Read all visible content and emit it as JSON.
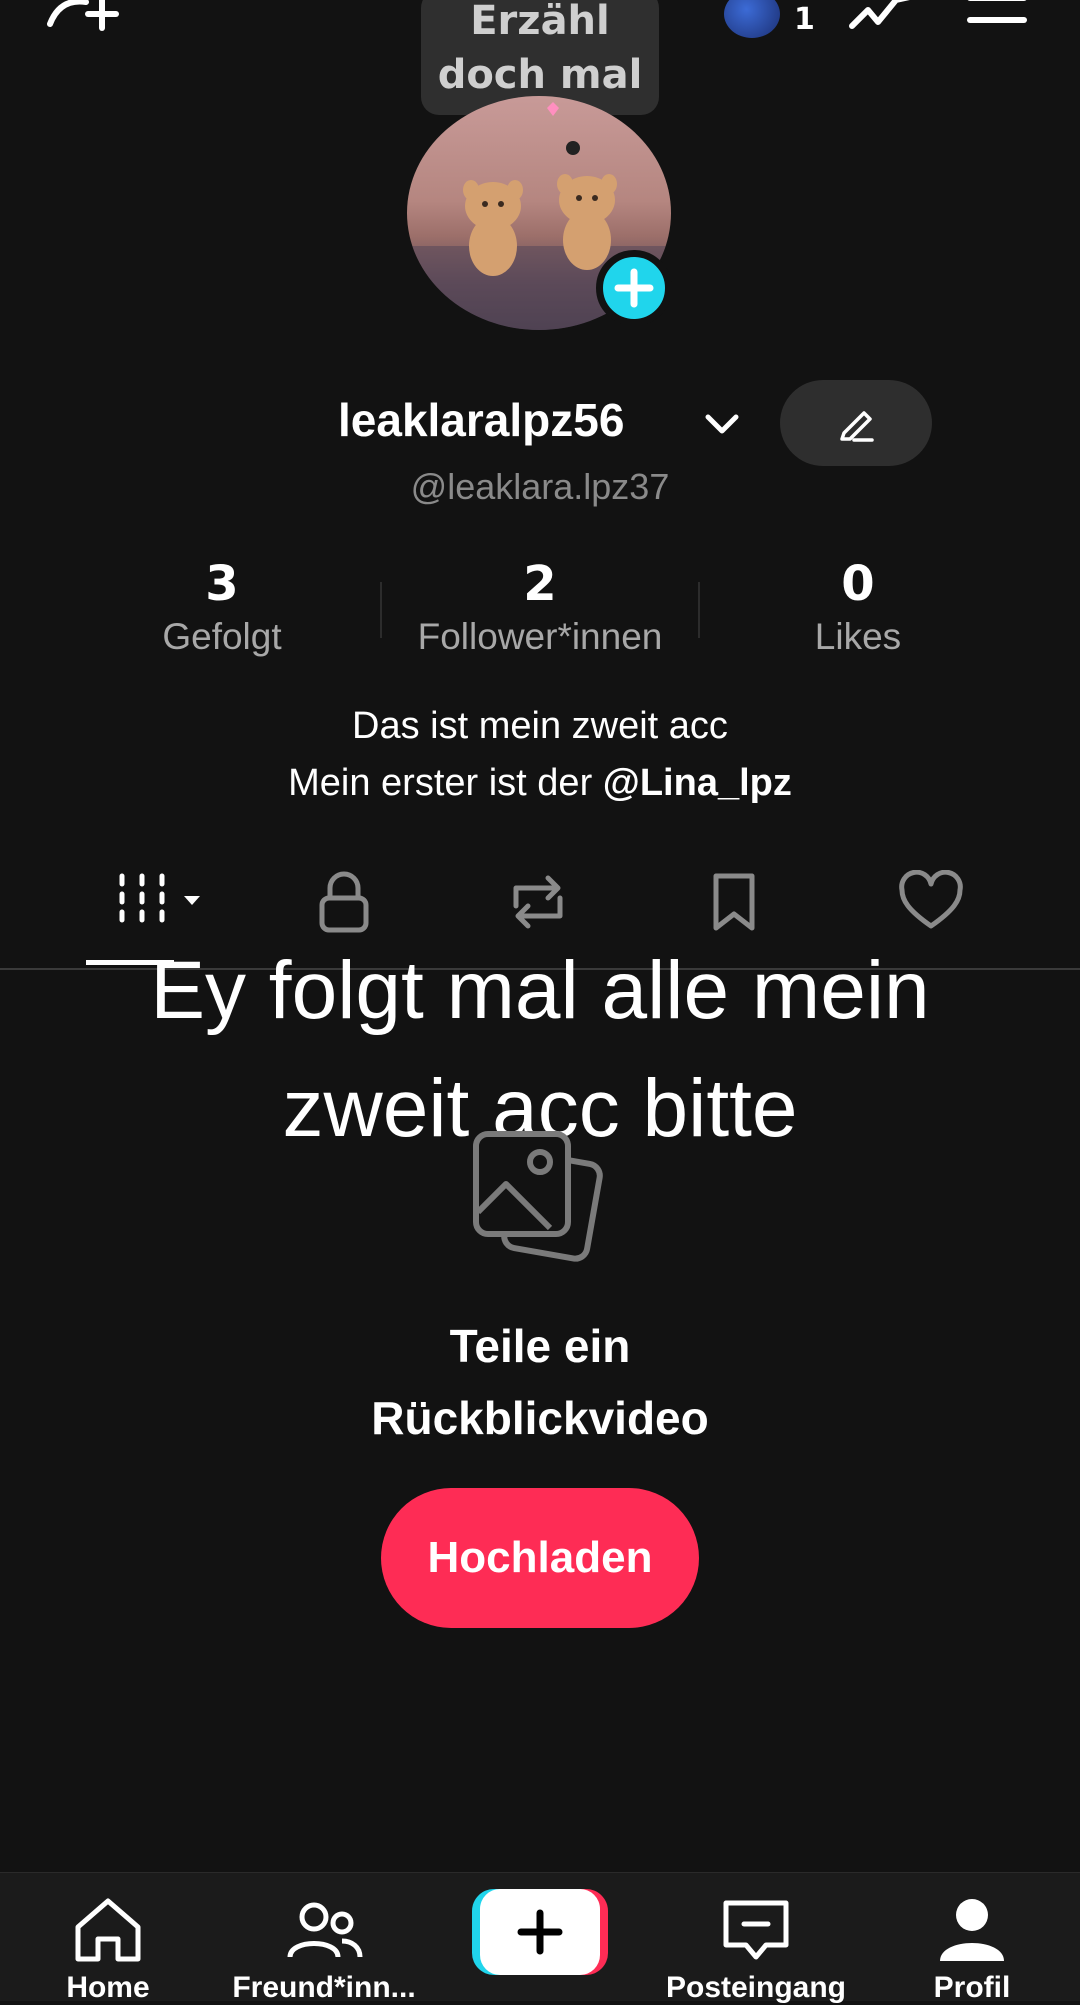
{
  "top_bar": {
    "bubble_text_line1": "Erzähl",
    "bubble_text_line2": "doch mal",
    "story_count": "1"
  },
  "profile": {
    "username": "leaklaralpz56",
    "handle": "@leaklara.lpz37",
    "stats": [
      {
        "value": "3",
        "label": "Gefolgt"
      },
      {
        "value": "2",
        "label": "Follower*innen"
      },
      {
        "value": "0",
        "label": "Likes"
      }
    ],
    "bio_line1": "Das ist mein zweit acc",
    "bio_line2_prefix": "Mein erster ist der ",
    "bio_line2_mention": "@Lina_lpz"
  },
  "tabs": [
    "videos-grid-icon",
    "lock-icon",
    "repost-icon",
    "bookmark-icon",
    "heart-icon"
  ],
  "overlay": {
    "line1": "Ey folgt mal alle mein",
    "line2": "zweit acc bitte"
  },
  "empty_state": {
    "line1": "Teile ein",
    "line2": "Rückblickvideo",
    "button": "Hochladen"
  },
  "bottom_nav": {
    "home": "Home",
    "friends": "Freund*inn...",
    "inbox": "Posteingang",
    "profile": "Profil"
  },
  "colors": {
    "accent_red": "#fe2c55",
    "accent_cyan": "#20d5ec",
    "background": "#121212"
  }
}
